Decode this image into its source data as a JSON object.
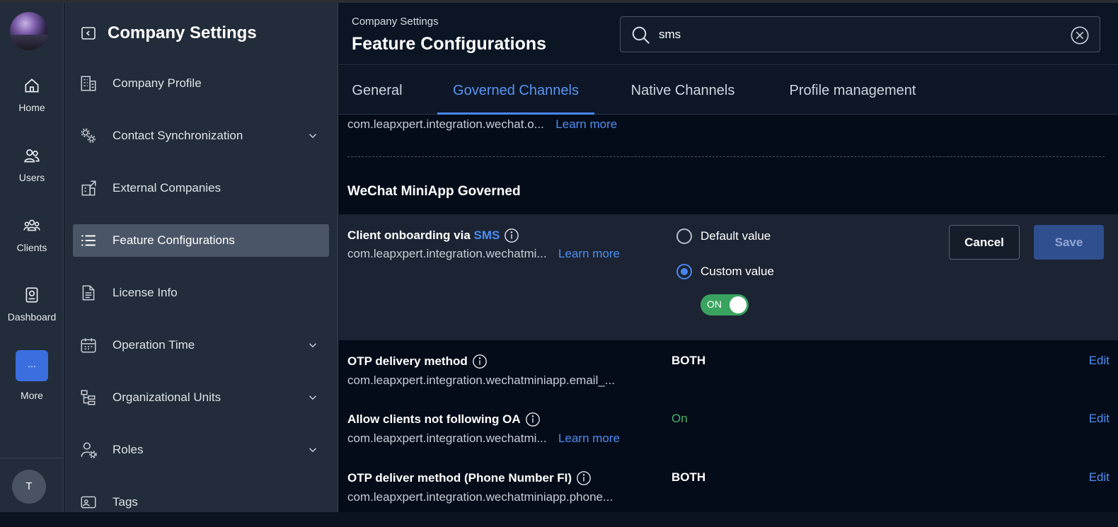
{
  "rail": {
    "items": [
      {
        "label": "Home"
      },
      {
        "label": "Users"
      },
      {
        "label": "Clients"
      },
      {
        "label": "Dashboard"
      },
      {
        "label": "More",
        "glyph": "..."
      }
    ],
    "user_initial": "T"
  },
  "sidebar": {
    "title": "Company Settings",
    "items": [
      {
        "label": "Company Profile",
        "icon": "building-icon"
      },
      {
        "label": "Contact Synchronization",
        "icon": "sync-gears-icon",
        "expandable": true
      },
      {
        "label": "External Companies",
        "icon": "external-building-icon"
      },
      {
        "label": "Feature Configurations",
        "icon": "list-icon",
        "active": true
      },
      {
        "label": "License Info",
        "icon": "document-icon"
      },
      {
        "label": "Operation Time",
        "icon": "calendar-icon",
        "expandable": true
      },
      {
        "label": "Organizational Units",
        "icon": "hierarchy-icon",
        "expandable": true
      },
      {
        "label": "Roles",
        "icon": "user-gear-icon",
        "expandable": true
      },
      {
        "label": "Tags",
        "icon": "tag-icon"
      }
    ]
  },
  "header": {
    "breadcrumb": "Company Settings",
    "title": "Feature Configurations"
  },
  "search": {
    "value": "sms",
    "placeholder": ""
  },
  "tabs": [
    {
      "label": "General"
    },
    {
      "label": "Governed Channels",
      "active": true
    },
    {
      "label": "Native Channels"
    },
    {
      "label": "Profile management"
    }
  ],
  "content": {
    "prev_item": {
      "key": "com.leapxpert.integration.wechat.o...",
      "learn_more": "Learn more"
    },
    "section_title": "WeChat MiniApp Governed",
    "editing": {
      "label_prefix": "Client onboarding via ",
      "label_highlight": "SMS",
      "key": "com.leapxpert.integration.wechatmi...",
      "learn_more": "Learn more",
      "options": [
        "Default value",
        "Custom value"
      ],
      "selected_option": "Custom value",
      "toggle_label": "ON",
      "cancel_label": "Cancel",
      "save_label": "Save"
    },
    "rows": [
      {
        "label": "OTP delivery method",
        "key": "com.leapxpert.integration.wechatminiapp.email_...",
        "value": "BOTH",
        "edit": "Edit"
      },
      {
        "label": "Allow clients not following OA",
        "key": "com.leapxpert.integration.wechatmi...",
        "learn_more": "Learn more",
        "value": "On",
        "edit": "Edit"
      },
      {
        "label": "OTP deliver method (Phone Number FI)",
        "key": "com.leapxpert.integration.wechatminiapp.phone...",
        "value": "BOTH",
        "edit": "Edit"
      }
    ]
  },
  "colors": {
    "accent": "#4a86ef",
    "on_green": "#49b36a",
    "toggle_green": "#3aa35f"
  }
}
